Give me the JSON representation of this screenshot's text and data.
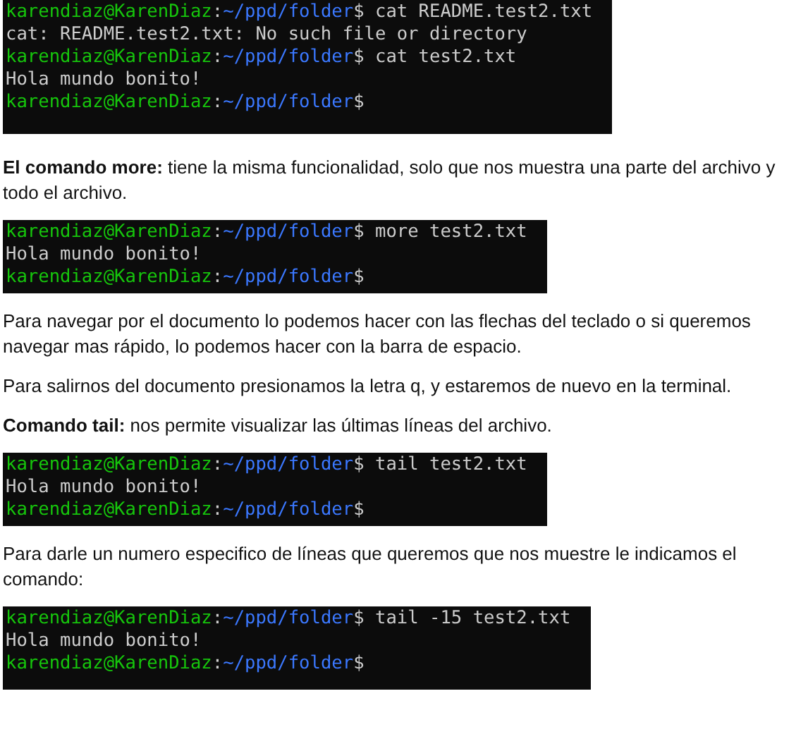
{
  "blocks": [
    {
      "kind": "terminal",
      "lines": [
        {
          "kind": "prompt",
          "user": "karendiaz@KarenDiaz",
          "separator": ":",
          "path": "~/ppd/folder",
          "symbol": "$",
          "command": "cat README.test2.txt"
        },
        {
          "kind": "output",
          "text": "cat: README.test2.txt: No such file or directory"
        },
        {
          "kind": "prompt",
          "user": "karendiaz@KarenDiaz",
          "separator": ":",
          "path": "~/ppd/folder",
          "symbol": "$",
          "command": "cat test2.txt"
        },
        {
          "kind": "output",
          "text": "Hola mundo bonito!"
        },
        {
          "kind": "prompt",
          "user": "karendiaz@KarenDiaz",
          "separator": ":",
          "path": "~/ppd/folder",
          "symbol": "$"
        }
      ]
    },
    {
      "kind": "paragraph",
      "text": "**El comando more:** tiene la misma funcionalidad, solo que nos muestra una parte del archivo y todo el archivo."
    },
    {
      "kind": "terminal",
      "lines": [
        {
          "kind": "prompt",
          "user": "karendiaz@KarenDiaz",
          "separator": ":",
          "path": "~/ppd/folder",
          "symbol": "$",
          "command": "more test2.txt"
        },
        {
          "kind": "output",
          "text": "Hola mundo bonito!"
        },
        {
          "kind": "prompt",
          "user": "karendiaz@KarenDiaz",
          "separator": ":",
          "path": "~/ppd/folder",
          "symbol": "$"
        }
      ]
    },
    {
      "kind": "paragraph",
      "text": "Para navegar por el documento lo podemos hacer con las flechas del teclado o si queremos navegar mas rápido, lo podemos hacer con la barra de espacio."
    },
    {
      "kind": "paragraph",
      "text": "Para salirnos del documento presionamos la letra q, y estaremos de nuevo en la terminal."
    },
    {
      "kind": "paragraph",
      "text": "**Comando tail:** nos permite visualizar las últimas líneas del archivo."
    },
    {
      "kind": "terminal",
      "lines": [
        {
          "kind": "prompt",
          "user": "karendiaz@KarenDiaz",
          "separator": ":",
          "path": "~/ppd/folder",
          "symbol": "$",
          "command": "tail test2.txt"
        },
        {
          "kind": "output",
          "text": "Hola mundo bonito!"
        },
        {
          "kind": "prompt",
          "user": "karendiaz@KarenDiaz",
          "separator": ":",
          "path": "~/ppd/folder",
          "symbol": "$"
        }
      ]
    },
    {
      "kind": "paragraph",
      "text": "Para darle un numero especifico de líneas que queremos que nos muestre le indicamos el comando:"
    },
    {
      "kind": "terminal",
      "lines": [
        {
          "kind": "prompt",
          "user": "karendiaz@KarenDiaz",
          "separator": ":",
          "path": "~/ppd/folder",
          "symbol": "$",
          "command": "tail -15 test2.txt"
        },
        {
          "kind": "output",
          "text": "Hola mundo bonito!"
        },
        {
          "kind": "prompt",
          "user": "karendiaz@KarenDiaz",
          "separator": ":",
          "path": "~/ppd/folder",
          "symbol": "$"
        }
      ]
    }
  ]
}
